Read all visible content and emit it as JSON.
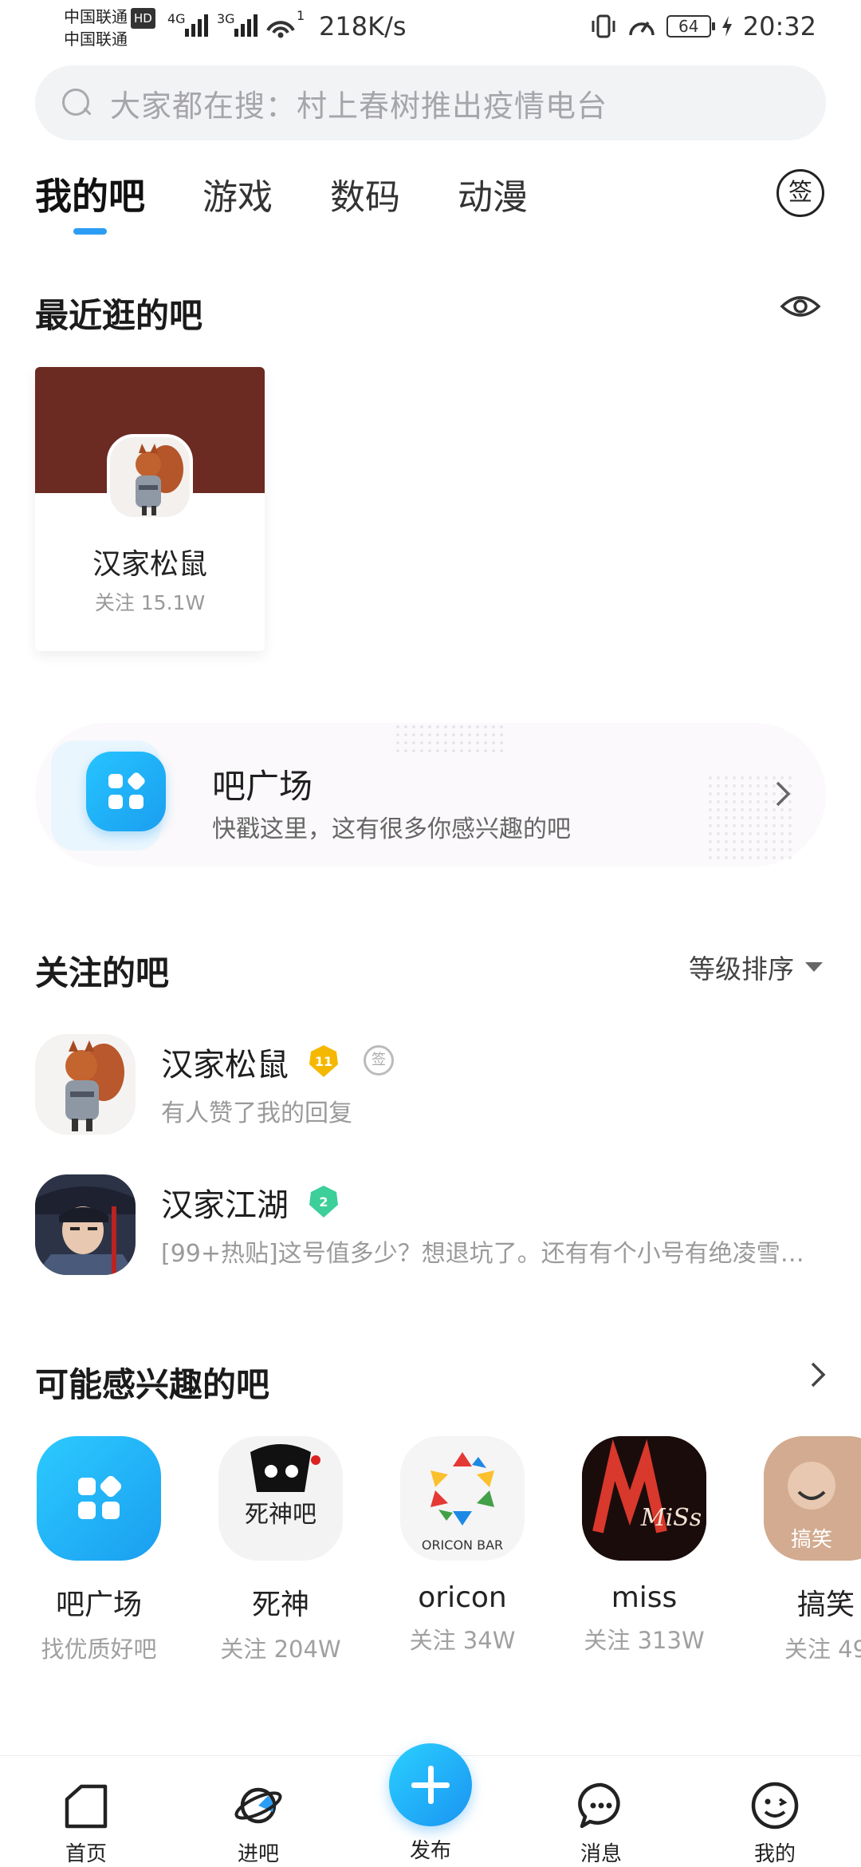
{
  "status_bar": {
    "carrier1": "中国联通",
    "carrier2": "中国联通",
    "hd": "HD",
    "net1": "4G",
    "net2": "3G",
    "wifi_count": "1",
    "speed": "218K/s",
    "battery": "64",
    "time": "20:32"
  },
  "search": {
    "placeholder": "大家都在搜：村上春树推出疫情电台"
  },
  "tabs": [
    {
      "label": "我的吧",
      "active": true
    },
    {
      "label": "游戏"
    },
    {
      "label": "数码"
    },
    {
      "label": "动漫"
    }
  ],
  "sign_in_label": "签",
  "recent": {
    "title": "最近逛的吧",
    "card": {
      "name": "汉家松鼠",
      "follow": "关注 15.1W"
    }
  },
  "plaza": {
    "title": "吧广场",
    "subtitle": "快戳这里，这有很多你感兴趣的吧"
  },
  "followed": {
    "title": "关注的吧",
    "sort_label": "等级排序",
    "items": [
      {
        "name": "汉家松鼠",
        "level": "11",
        "desc": "有人赞了我的回复",
        "sign": "签"
      },
      {
        "name": "汉家江湖",
        "level": "2",
        "desc": "[99+热贴]这号值多少？想退坑了。还有有个小号有绝凌雪…"
      }
    ]
  },
  "interest": {
    "title": "可能感兴趣的吧",
    "items": [
      {
        "name": "吧广场",
        "sub": "找优质好吧"
      },
      {
        "name": "死神",
        "sub": "关注 204W",
        "art_text": "死神吧"
      },
      {
        "name": "oricon",
        "sub": "关注 34W",
        "art_text": "ORICON BAR"
      },
      {
        "name": "miss",
        "sub": "关注 313W",
        "art_text": "MiSs"
      },
      {
        "name": "搞笑",
        "sub": "关注 49",
        "art_text": "搞笑"
      }
    ]
  },
  "bottom_nav": {
    "home": "首页",
    "enter": "进吧",
    "publish": "发布",
    "messages": "消息",
    "mine": "我的"
  },
  "colors": {
    "accent": "#2c9df5",
    "banner": "#6b2a22",
    "level_gold": "#f5b800",
    "level_green": "#3ccf9a"
  }
}
